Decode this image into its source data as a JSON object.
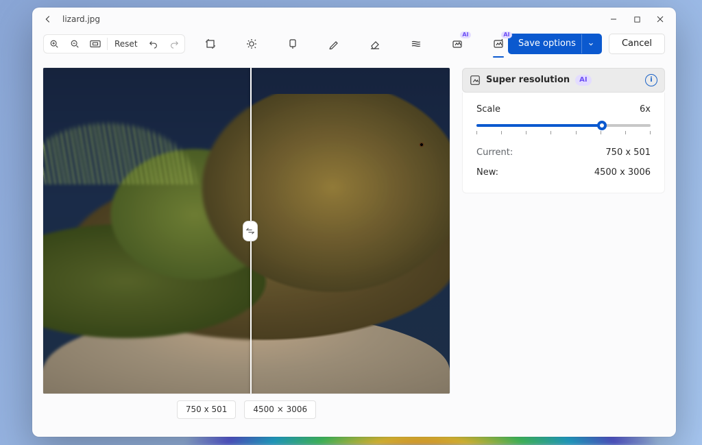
{
  "file": {
    "name": "lizard.jpg"
  },
  "toolbar": {
    "zoom_in": "zoom-in",
    "zoom_out": "zoom-out",
    "fit": "fit",
    "reset": "Reset",
    "undo": "undo",
    "redo": "redo",
    "tools": [
      {
        "id": "crop",
        "name": "crop-icon",
        "ai": false,
        "active": false
      },
      {
        "id": "adjust",
        "name": "brightness-icon",
        "ai": false,
        "active": false
      },
      {
        "id": "filter",
        "name": "filter-icon",
        "ai": false,
        "active": false
      },
      {
        "id": "markup",
        "name": "pencil-icon",
        "ai": false,
        "active": false
      },
      {
        "id": "erase",
        "name": "eraser-icon",
        "ai": false,
        "active": false
      },
      {
        "id": "blur",
        "name": "blur-icon",
        "ai": false,
        "active": false
      },
      {
        "id": "gen",
        "name": "generative-erase-icon",
        "ai": true,
        "active": false
      },
      {
        "id": "superres",
        "name": "super-resolution-icon",
        "ai": true,
        "active": true
      }
    ],
    "ai_label": "AI",
    "save_label": "Save options",
    "cancel_label": "Cancel"
  },
  "canvas": {
    "left_dim": "750 x 501",
    "right_dim": "4500 × 3006",
    "split_pct": 51
  },
  "panel": {
    "title": "Super resolution",
    "ai_label": "AI",
    "scale_label": "Scale",
    "scale_value": "6x",
    "slider_pct": 72,
    "tick_count": 8,
    "current_label": "Current:",
    "current_value": "750 x 501",
    "new_label": "New:",
    "new_value": "4500 x 3006"
  }
}
